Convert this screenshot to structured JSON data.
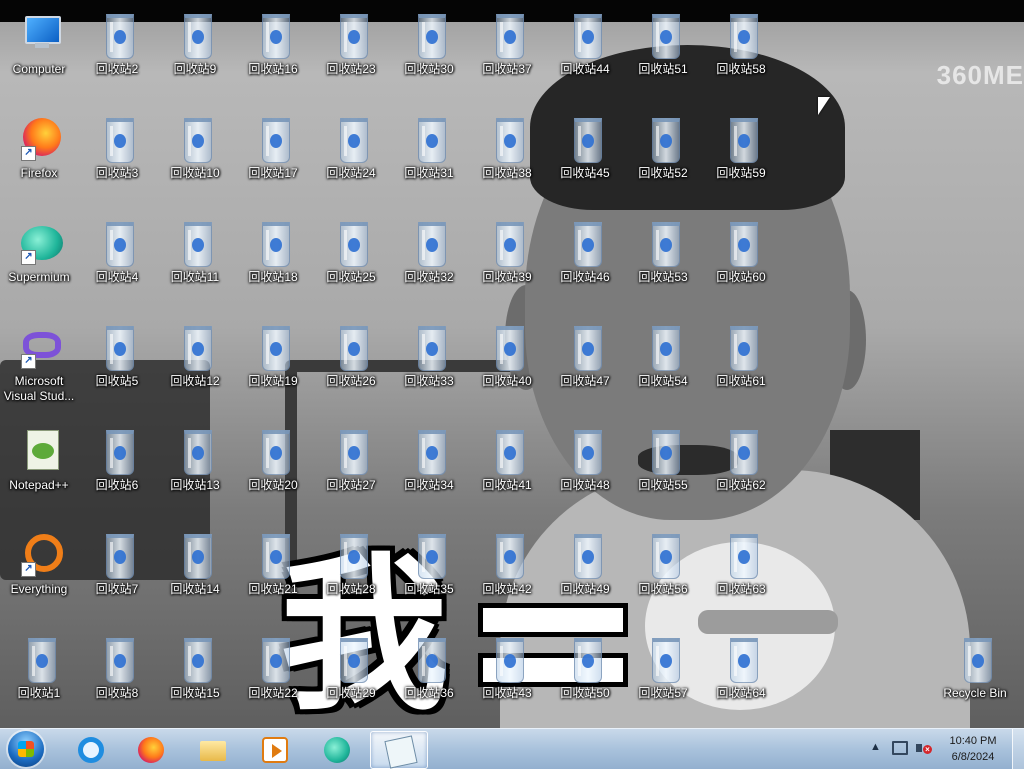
{
  "wallpaper": {
    "watermark": "360ME",
    "caption_char": "我"
  },
  "desktop": {
    "left_column": [
      {
        "label": "Computer",
        "icon": "computer-icon",
        "shortcut": false
      },
      {
        "label": "Firefox",
        "icon": "firefox-icon",
        "shortcut": true
      },
      {
        "label": "Supermium",
        "icon": "supermium-icon",
        "shortcut": true
      },
      {
        "label": "Microsoft Visual Stud...",
        "icon": "visual-studio-icon",
        "shortcut": true
      },
      {
        "label": "Notepad++",
        "icon": "notepadpp-icon",
        "shortcut": false
      },
      {
        "label": "Everything",
        "icon": "everything-icon",
        "shortcut": true
      },
      {
        "label": "回收站1",
        "icon": "recycle-bin-icon",
        "shortcut": false
      }
    ],
    "recycle_columns": [
      [
        "回收站2",
        "回收站3",
        "回收站4",
        "回收站5",
        "回收站6",
        "回收站7",
        "回收站8"
      ],
      [
        "回收站9",
        "回收站10",
        "回收站11",
        "回收站12",
        "回收站13",
        "回收站14",
        "回收站15"
      ],
      [
        "回收站16",
        "回收站17",
        "回收站18",
        "回收站19",
        "回收站20",
        "回收站21",
        "回收站22"
      ],
      [
        "回收站23",
        "回收站24",
        "回收站25",
        "回收站26",
        "回收站27",
        "回收站28",
        "回收站29"
      ],
      [
        "回收站30",
        "回收站31",
        "回收站32",
        "回收站33",
        "回收站34",
        "回收站35",
        "回收站36"
      ],
      [
        "回收站37",
        "回收站38",
        "回收站39",
        "回收站40",
        "回收站41",
        "回收站42",
        "回收站43"
      ],
      [
        "回收站44",
        "回收站45",
        "回收站46",
        "回收站47",
        "回收站48",
        "回收站49",
        "回收站50"
      ],
      [
        "回收站51",
        "回收站52",
        "回收站53",
        "回收站54",
        "回收站55",
        "回收站56",
        "回收站57"
      ],
      [
        "回收站58",
        "回收站59",
        "回收站60",
        "回收站61",
        "回收站62",
        "回收站63",
        "回收站64"
      ]
    ],
    "recycle_bin": {
      "label": "Recycle Bin",
      "icon": "recycle-bin-icon"
    }
  },
  "taskbar": {
    "start_icon": "windows-start-icon",
    "apps": [
      {
        "name": "internet-explorer",
        "icon": "internet-explorer-icon",
        "active": false
      },
      {
        "name": "firefox",
        "icon": "firefox-icon",
        "active": false
      },
      {
        "name": "file-explorer",
        "icon": "folder-icon",
        "active": false
      },
      {
        "name": "media-player",
        "icon": "media-player-icon",
        "active": false
      },
      {
        "name": "supermium",
        "icon": "supermium-icon",
        "active": false
      },
      {
        "name": "notepad",
        "icon": "notepad-icon",
        "active": true
      }
    ],
    "tray": {
      "arrow": "▲",
      "time": "10:40 PM",
      "date": "6/8/2024"
    }
  },
  "colors": {
    "taskbar": "#a9c2dc",
    "label_text": "#ffffff",
    "caption_outline": "#000000"
  }
}
